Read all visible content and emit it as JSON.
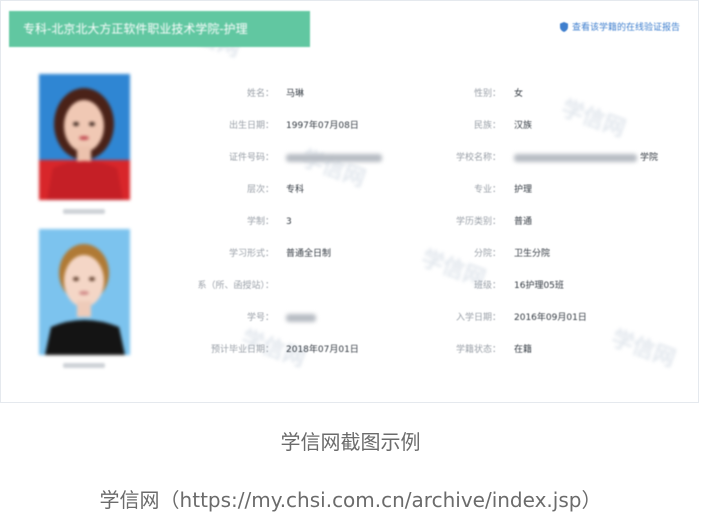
{
  "header": {
    "banner_title": "专科-北京北大方正软件职业技术学院-护理",
    "verify_link": "查看该学籍的在线验证报告"
  },
  "watermark_text": "学信网",
  "colors": {
    "banner": "#61c7a1",
    "link": "#3f7fce",
    "label": "#9aa0a8",
    "value": "#333a42"
  },
  "record": {
    "left": [
      {
        "label": "姓名：",
        "value": "马琳",
        "blurred": false
      },
      {
        "label": "出生日期：",
        "value": "1997年07月08日",
        "blurred": false
      },
      {
        "label": "证件号码：",
        "value": "",
        "blurred": true
      },
      {
        "label": "层次：",
        "value": "专科",
        "blurred": false
      },
      {
        "label": "学制：",
        "value": "3",
        "blurred": false
      },
      {
        "label": "学习形式：",
        "value": "普通全日制",
        "blurred": false
      },
      {
        "label": "系（所、函授站）：",
        "value": "",
        "blurred": false
      },
      {
        "label": "学号：",
        "value": "",
        "blurred": true
      },
      {
        "label": "预计毕业日期：",
        "value": "2018年07月01日",
        "blurred": false
      }
    ],
    "right": [
      {
        "label": "性别：",
        "value": "女",
        "blurred": false
      },
      {
        "label": "民族：",
        "value": "汉族",
        "blurred": false
      },
      {
        "label": "学校名称：",
        "value": "学院",
        "blurred": true
      },
      {
        "label": "专业：",
        "value": "护理",
        "blurred": false
      },
      {
        "label": "学历类别：",
        "value": "普通",
        "blurred": false
      },
      {
        "label": "分院：",
        "value": "卫生分院",
        "blurred": false
      },
      {
        "label": "班级：",
        "value": "16护理05班",
        "blurred": false
      },
      {
        "label": "入学日期：",
        "value": "2016年09月01日",
        "blurred": false
      },
      {
        "label": "学籍状态：",
        "value": "在籍",
        "blurred": false
      }
    ]
  },
  "captions": {
    "example": "学信网截图示例",
    "source": "学信网（https://my.chsi.com.cn/archive/index.jsp）"
  }
}
